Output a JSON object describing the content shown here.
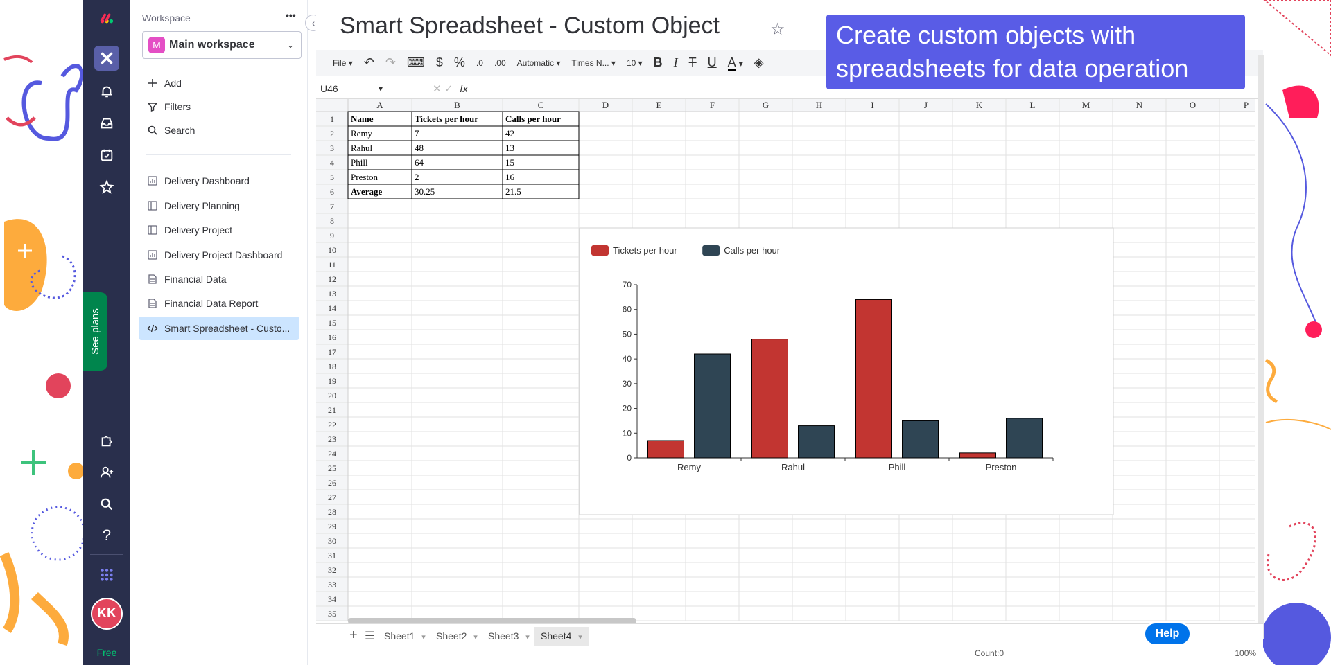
{
  "sidebar": {
    "workspace_label": "Workspace",
    "more_label": "•••",
    "workspace_name": "Main workspace",
    "workspace_initial": "M",
    "add_label": "Add",
    "filters_label": "Filters",
    "search_label": "Search",
    "items": [
      {
        "label": "Delivery Dashboard",
        "icon": "dashboard-icon"
      },
      {
        "label": "Delivery Planning",
        "icon": "board-icon"
      },
      {
        "label": "Delivery Project",
        "icon": "board-icon"
      },
      {
        "label": "Delivery Project Dashboard",
        "icon": "dashboard-icon"
      },
      {
        "label": "Financial Data",
        "icon": "doc-icon"
      },
      {
        "label": "Financial Data Report",
        "icon": "doc-icon"
      },
      {
        "label": "Smart Spreadsheet - Custo...",
        "icon": "code-icon",
        "selected": true
      }
    ]
  },
  "rail": {
    "see_plans": "See plans",
    "avatar_initials": "KK",
    "free_label": "Free"
  },
  "page": {
    "title": "Smart Spreadsheet - Custom Object",
    "tooltip": "Create custom objects with spreadsheets for data operation"
  },
  "toolbar": {
    "file": "File",
    "currency": "$",
    "percent": "%",
    "dec_more": ".0",
    "dec_less": ".00",
    "format": "Automatic",
    "font": "Times N...",
    "size": "10",
    "bold": "B",
    "italic": "I",
    "strike": "T",
    "underline": "U",
    "text_color": "A"
  },
  "formula_bar": {
    "cell_ref": "U46",
    "fx": "fx"
  },
  "sheet": {
    "columns": [
      "A",
      "B",
      "C",
      "D",
      "E",
      "F",
      "G",
      "H",
      "I",
      "J",
      "K",
      "L",
      "M",
      "N",
      "O",
      "P"
    ],
    "rows": [
      "1",
      "2",
      "3",
      "4",
      "5",
      "6",
      "7",
      "8",
      "9",
      "10",
      "11",
      "12",
      "13",
      "14",
      "15",
      "16",
      "17",
      "18",
      "19",
      "20",
      "21",
      "22",
      "23",
      "24",
      "25",
      "26",
      "27",
      "28",
      "29",
      "30",
      "31",
      "32",
      "33",
      "34",
      "35"
    ],
    "table": [
      [
        "Name",
        "Tickets per hour",
        "Calls per hour"
      ],
      [
        "Remy",
        "7",
        "42"
      ],
      [
        "Rahul",
        "48",
        "13"
      ],
      [
        "Phill",
        "64",
        "15"
      ],
      [
        "Preston",
        "2",
        "16"
      ],
      [
        "Average",
        "30.25",
        "21.5"
      ]
    ]
  },
  "chart_data": {
    "type": "bar",
    "categories": [
      "Remy",
      "Rahul",
      "Phill",
      "Preston"
    ],
    "series": [
      {
        "name": "Tickets per hour",
        "values": [
          7,
          48,
          64,
          2
        ],
        "color": "#c23531"
      },
      {
        "name": "Calls per hour",
        "values": [
          42,
          13,
          15,
          16
        ],
        "color": "#2f4554"
      }
    ],
    "ylim": [
      0,
      70
    ],
    "yticks": [
      "0",
      "10",
      "20",
      "30",
      "40",
      "50",
      "60",
      "70"
    ],
    "legend": "top-left",
    "grid": false
  },
  "tabs": {
    "add": "+",
    "menu": "☰",
    "sheets": [
      "Sheet1",
      "Sheet2",
      "Sheet3",
      "Sheet4"
    ],
    "active": "Sheet4"
  },
  "help_label": "Help",
  "status": {
    "count": "Count:0",
    "zoom": "100%"
  },
  "colors": {
    "rail": "#292f4c",
    "tooltip": "#595ce6",
    "selected": "#cce5ff",
    "help": "#0073ea"
  }
}
